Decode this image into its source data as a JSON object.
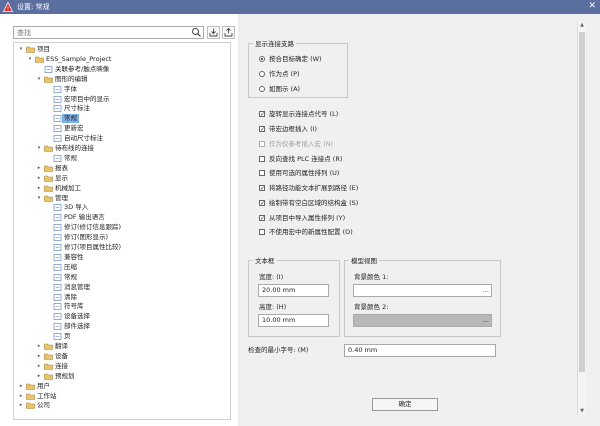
{
  "window": {
    "title": "设置: 常规",
    "close_glyph": "✕"
  },
  "search": {
    "placeholder": "查找"
  },
  "tree": [
    {
      "label": "项目",
      "toggle": "▾",
      "icon": "folder-icon"
    },
    {
      "label": "ESS_Sample_Project",
      "toggle": "▾",
      "icon": "folder-icon"
    },
    {
      "label": "关联参考/触点映像",
      "toggle": "",
      "icon": "page-icon"
    },
    {
      "label": "图形的编辑",
      "toggle": "▾",
      "icon": "folder-icon"
    },
    {
      "label": "字体",
      "toggle": "",
      "icon": "page-icon"
    },
    {
      "label": "宏项目中的显示",
      "toggle": "",
      "icon": "page-icon"
    },
    {
      "label": "尺寸标注",
      "toggle": "",
      "icon": "page-icon"
    },
    {
      "label": "常规",
      "toggle": "",
      "icon": "page-icon",
      "selected": true
    },
    {
      "label": "更新宏",
      "toggle": "",
      "icon": "page-icon"
    },
    {
      "label": "自动尺寸标注",
      "toggle": "",
      "icon": "page-icon"
    },
    {
      "label": "待布线的连接",
      "toggle": "▾",
      "icon": "folder-icon"
    },
    {
      "label": "常规",
      "toggle": "",
      "icon": "page-icon"
    },
    {
      "label": "报表",
      "toggle": "▸",
      "icon": "folder-icon"
    },
    {
      "label": "显示",
      "toggle": "▸",
      "icon": "folder-icon"
    },
    {
      "label": "机械加工",
      "toggle": "▸",
      "icon": "folder-icon"
    },
    {
      "label": "管理",
      "toggle": "▾",
      "icon": "folder-icon"
    },
    {
      "label": "3D 导入",
      "toggle": "",
      "icon": "page-icon"
    },
    {
      "label": "PDF 输出语言",
      "toggle": "",
      "icon": "page-icon"
    },
    {
      "label": "修订(修订信息跟踪)",
      "toggle": "",
      "icon": "page-icon"
    },
    {
      "label": "修订(图形显示)",
      "toggle": "",
      "icon": "page-icon"
    },
    {
      "label": "修订(项目属性比较)",
      "toggle": "",
      "icon": "page-icon"
    },
    {
      "label": "兼容性",
      "toggle": "",
      "icon": "page-icon"
    },
    {
      "label": "压缩",
      "toggle": "",
      "icon": "page-icon"
    },
    {
      "label": "常规",
      "toggle": "",
      "icon": "page-icon"
    },
    {
      "label": "消息管理",
      "toggle": "",
      "icon": "page-icon"
    },
    {
      "label": "清除",
      "toggle": "",
      "icon": "page-icon"
    },
    {
      "label": "符号库",
      "toggle": "",
      "icon": "page-icon"
    },
    {
      "label": "设备选择",
      "toggle": "",
      "icon": "page-icon"
    },
    {
      "label": "部件选择",
      "toggle": "",
      "icon": "page-icon"
    },
    {
      "label": "页",
      "toggle": "",
      "icon": "page-icon"
    },
    {
      "label": "翻译",
      "toggle": "▸",
      "icon": "folder-icon"
    },
    {
      "label": "设备",
      "toggle": "▸",
      "icon": "folder-icon"
    },
    {
      "label": "连接",
      "toggle": "▸",
      "icon": "folder-icon"
    },
    {
      "label": "预规划",
      "toggle": "▸",
      "icon": "folder-icon"
    },
    {
      "label": "用户",
      "toggle": "▸",
      "icon": "folder-icon"
    },
    {
      "label": "工作站",
      "toggle": "▸",
      "icon": "folder-icon"
    },
    {
      "label": "公司",
      "toggle": "▸",
      "icon": "folder-icon"
    }
  ],
  "display_connection_points": {
    "legend": "显示连接支路",
    "options": [
      {
        "label": "按合目标确定 (W)",
        "selected": true
      },
      {
        "label": "作为点 (P)",
        "selected": false
      },
      {
        "label": "如图示 (A)",
        "selected": false
      }
    ]
  },
  "checkboxes": [
    {
      "label": "旋转显示连接点代号 (L)",
      "checked": true,
      "disabled": false
    },
    {
      "label": "带宏边框插入 (I)",
      "checked": true,
      "disabled": false
    },
    {
      "label": "作为仅参考插入宏 (N)",
      "checked": false,
      "disabled": true
    },
    {
      "label": "反向查找 PLC 连接点 (R)",
      "checked": false,
      "disabled": false
    },
    {
      "label": "使用可选的属性排列 (U)",
      "checked": false,
      "disabled": false
    },
    {
      "label": "将路径功能文本扩展到路径 (E)",
      "checked": true,
      "disabled": false
    },
    {
      "label": "绘制带有空白区域的结构盒 (S)",
      "checked": true,
      "disabled": false
    },
    {
      "label": "从项目中导入属性排列 (Y)",
      "checked": true,
      "disabled": false
    },
    {
      "label": "不使用宏中的新属性配置 (O)",
      "checked": false,
      "disabled": false
    }
  ],
  "text_frame": {
    "legend": "文本框",
    "width_label": "宽度: (I)",
    "width_value": "20.00 mm",
    "height_label": "高度: (H)",
    "height_value": "10.00 mm"
  },
  "model_view": {
    "legend": "模型视图",
    "bg1_label": "背景颜色 1:",
    "bg2_label": "背景颜色 2:",
    "dots": "..."
  },
  "min_font": {
    "label": "检查的最小字号: (M)",
    "value": "0.40 mm"
  },
  "ok_button": "确定",
  "colors": {
    "titlebar": "#5a6ea0",
    "selection": "#7fb0e6",
    "panel": "#f0f0f0"
  }
}
